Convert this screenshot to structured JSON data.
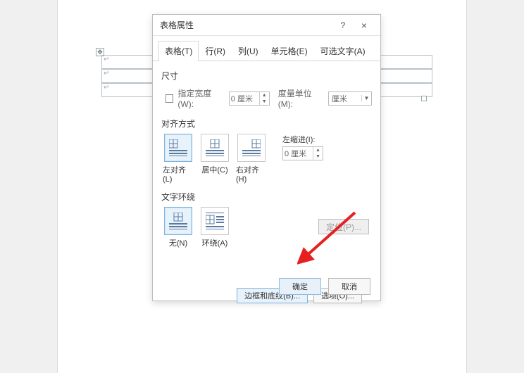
{
  "dialog": {
    "title": "表格属性",
    "help": "?",
    "close": "×"
  },
  "tabs": {
    "table": "表格(T)",
    "row": "行(R)",
    "column": "列(U)",
    "cell": "单元格(E)",
    "alt": "可选文字(A)"
  },
  "size": {
    "section": "尺寸",
    "specify_width": "指定宽度(W):",
    "width_value": "0 厘米",
    "unit_label": "度量单位(M):",
    "unit_value": "厘米"
  },
  "align": {
    "section": "对齐方式",
    "left": "左对齐(L)",
    "center": "居中(C)",
    "right": "右对齐(H)",
    "indent_label": "左缩进(I):",
    "indent_value": "0 厘米"
  },
  "wrap": {
    "section": "文字环绕",
    "none": "无(N)",
    "around": "环绕(A)"
  },
  "buttons": {
    "position": "定位(P)...",
    "borders": "边框和底纹(B)...",
    "options": "选项(O)...",
    "ok": "确定",
    "cancel": "取消"
  },
  "bg": {
    "paramark": "↵",
    "handle": "✥"
  }
}
